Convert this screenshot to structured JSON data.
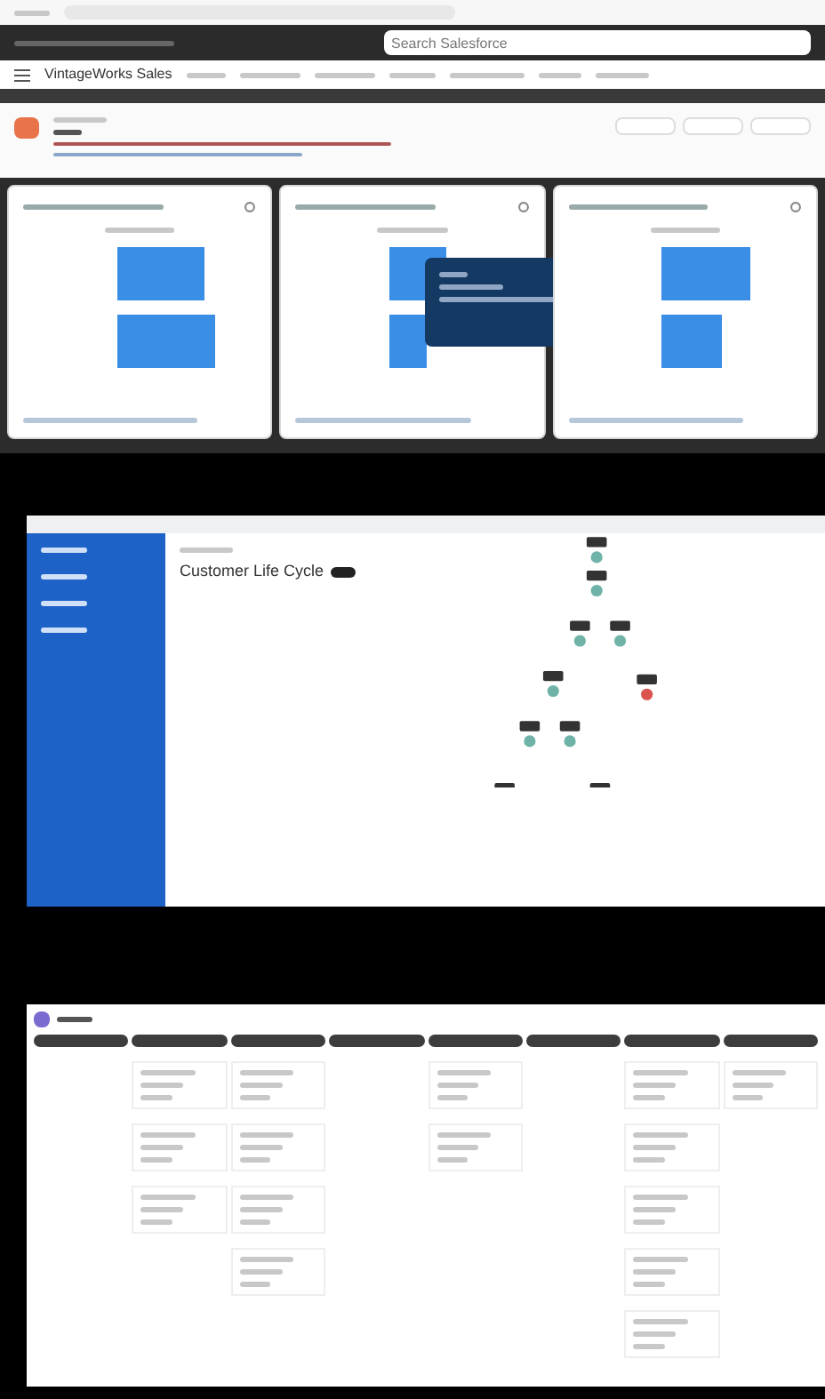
{
  "dashboard": {
    "app_name": "VintageWorks Sales",
    "search": {
      "placeholder": "Search Salesforce"
    },
    "cards": [
      {
        "tooltip": false
      },
      {
        "tooltip": true
      },
      {
        "tooltip": false
      }
    ]
  },
  "flow": {
    "title": "Customer Life Cycle"
  }
}
